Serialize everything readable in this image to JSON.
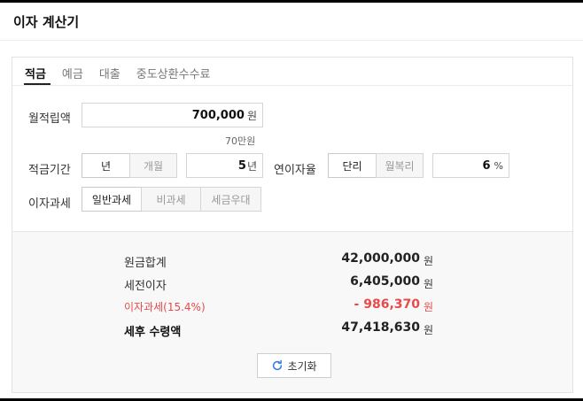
{
  "header": {
    "title": "이자 계산기"
  },
  "tabs": [
    {
      "label": "적금"
    },
    {
      "label": "예금"
    },
    {
      "label": "대출"
    },
    {
      "label": "중도상환수수료"
    }
  ],
  "form": {
    "monthly_deposit": {
      "label": "월적립액",
      "value": "700,000",
      "unit": "원",
      "hint": "70만원"
    },
    "period": {
      "label": "적금기간",
      "options": [
        "년",
        "개월"
      ],
      "selected": "년",
      "value": "5",
      "unit": "년"
    },
    "rate": {
      "label": "연이자율",
      "options": [
        "단리",
        "월복리"
      ],
      "selected": "단리",
      "value": "6",
      "unit": "%"
    },
    "tax": {
      "label": "이자과세",
      "options": [
        "일반과세",
        "비과세",
        "세금우대"
      ],
      "selected": "일반과세"
    }
  },
  "result": {
    "principal": {
      "label": "원금합계",
      "value": "42,000,000",
      "unit": "원"
    },
    "pretax_interest": {
      "label": "세전이자",
      "value": "6,405,000",
      "unit": "원"
    },
    "interest_tax": {
      "label": "이자과세(15.4%)",
      "value": "- 986,370",
      "unit": "원"
    },
    "net_amount": {
      "label": "세후 수령액",
      "value": "47,418,630",
      "unit": "원"
    },
    "reset_label": "초기화"
  },
  "colors": {
    "accent_red": "#e84a4a",
    "reset_icon": "#3b7ddd"
  }
}
